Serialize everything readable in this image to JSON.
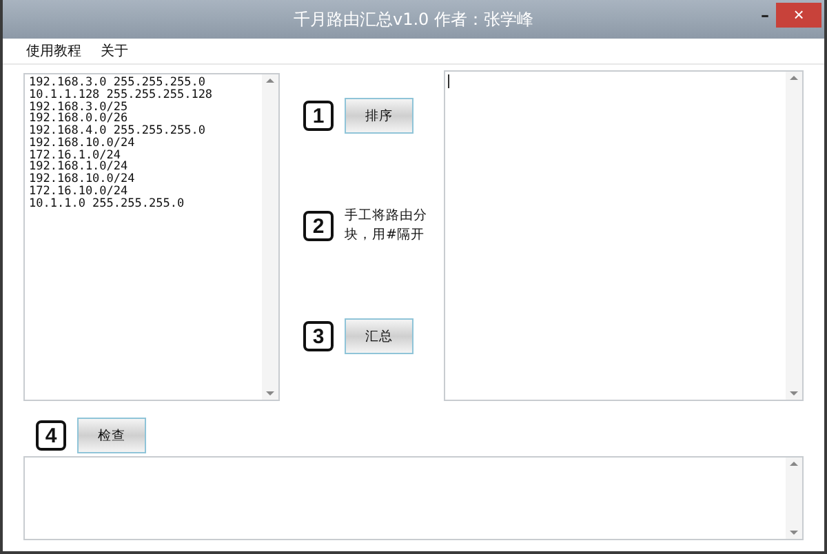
{
  "window": {
    "title": "千月路由汇总v1.0   作者：张学峰",
    "minimize": "–",
    "close": "×"
  },
  "menu": [
    {
      "label": "使用教程"
    },
    {
      "label": "关于"
    }
  ],
  "input_lines": [
    "192.168.3.0 255.255.255.0",
    "10.1.1.128 255.255.255.128",
    "192.168.3.0/25",
    "192.168.0.0/26",
    "192.168.4.0 255.255.255.0",
    "192.168.10.0/24",
    "172.16.1.0/24",
    "192.168.1.0/24",
    "192.168.10.0/24",
    "172.16.10.0/24",
    "10.1.1.0 255.255.255.0"
  ],
  "steps": [
    {
      "number": "1",
      "kind": "button",
      "label": "排序"
    },
    {
      "number": "2",
      "kind": "note",
      "label": "手工将路由分块，用#隔开"
    },
    {
      "number": "3",
      "kind": "button",
      "label": "汇总"
    }
  ],
  "check": {
    "number": "4",
    "label": "检查"
  }
}
